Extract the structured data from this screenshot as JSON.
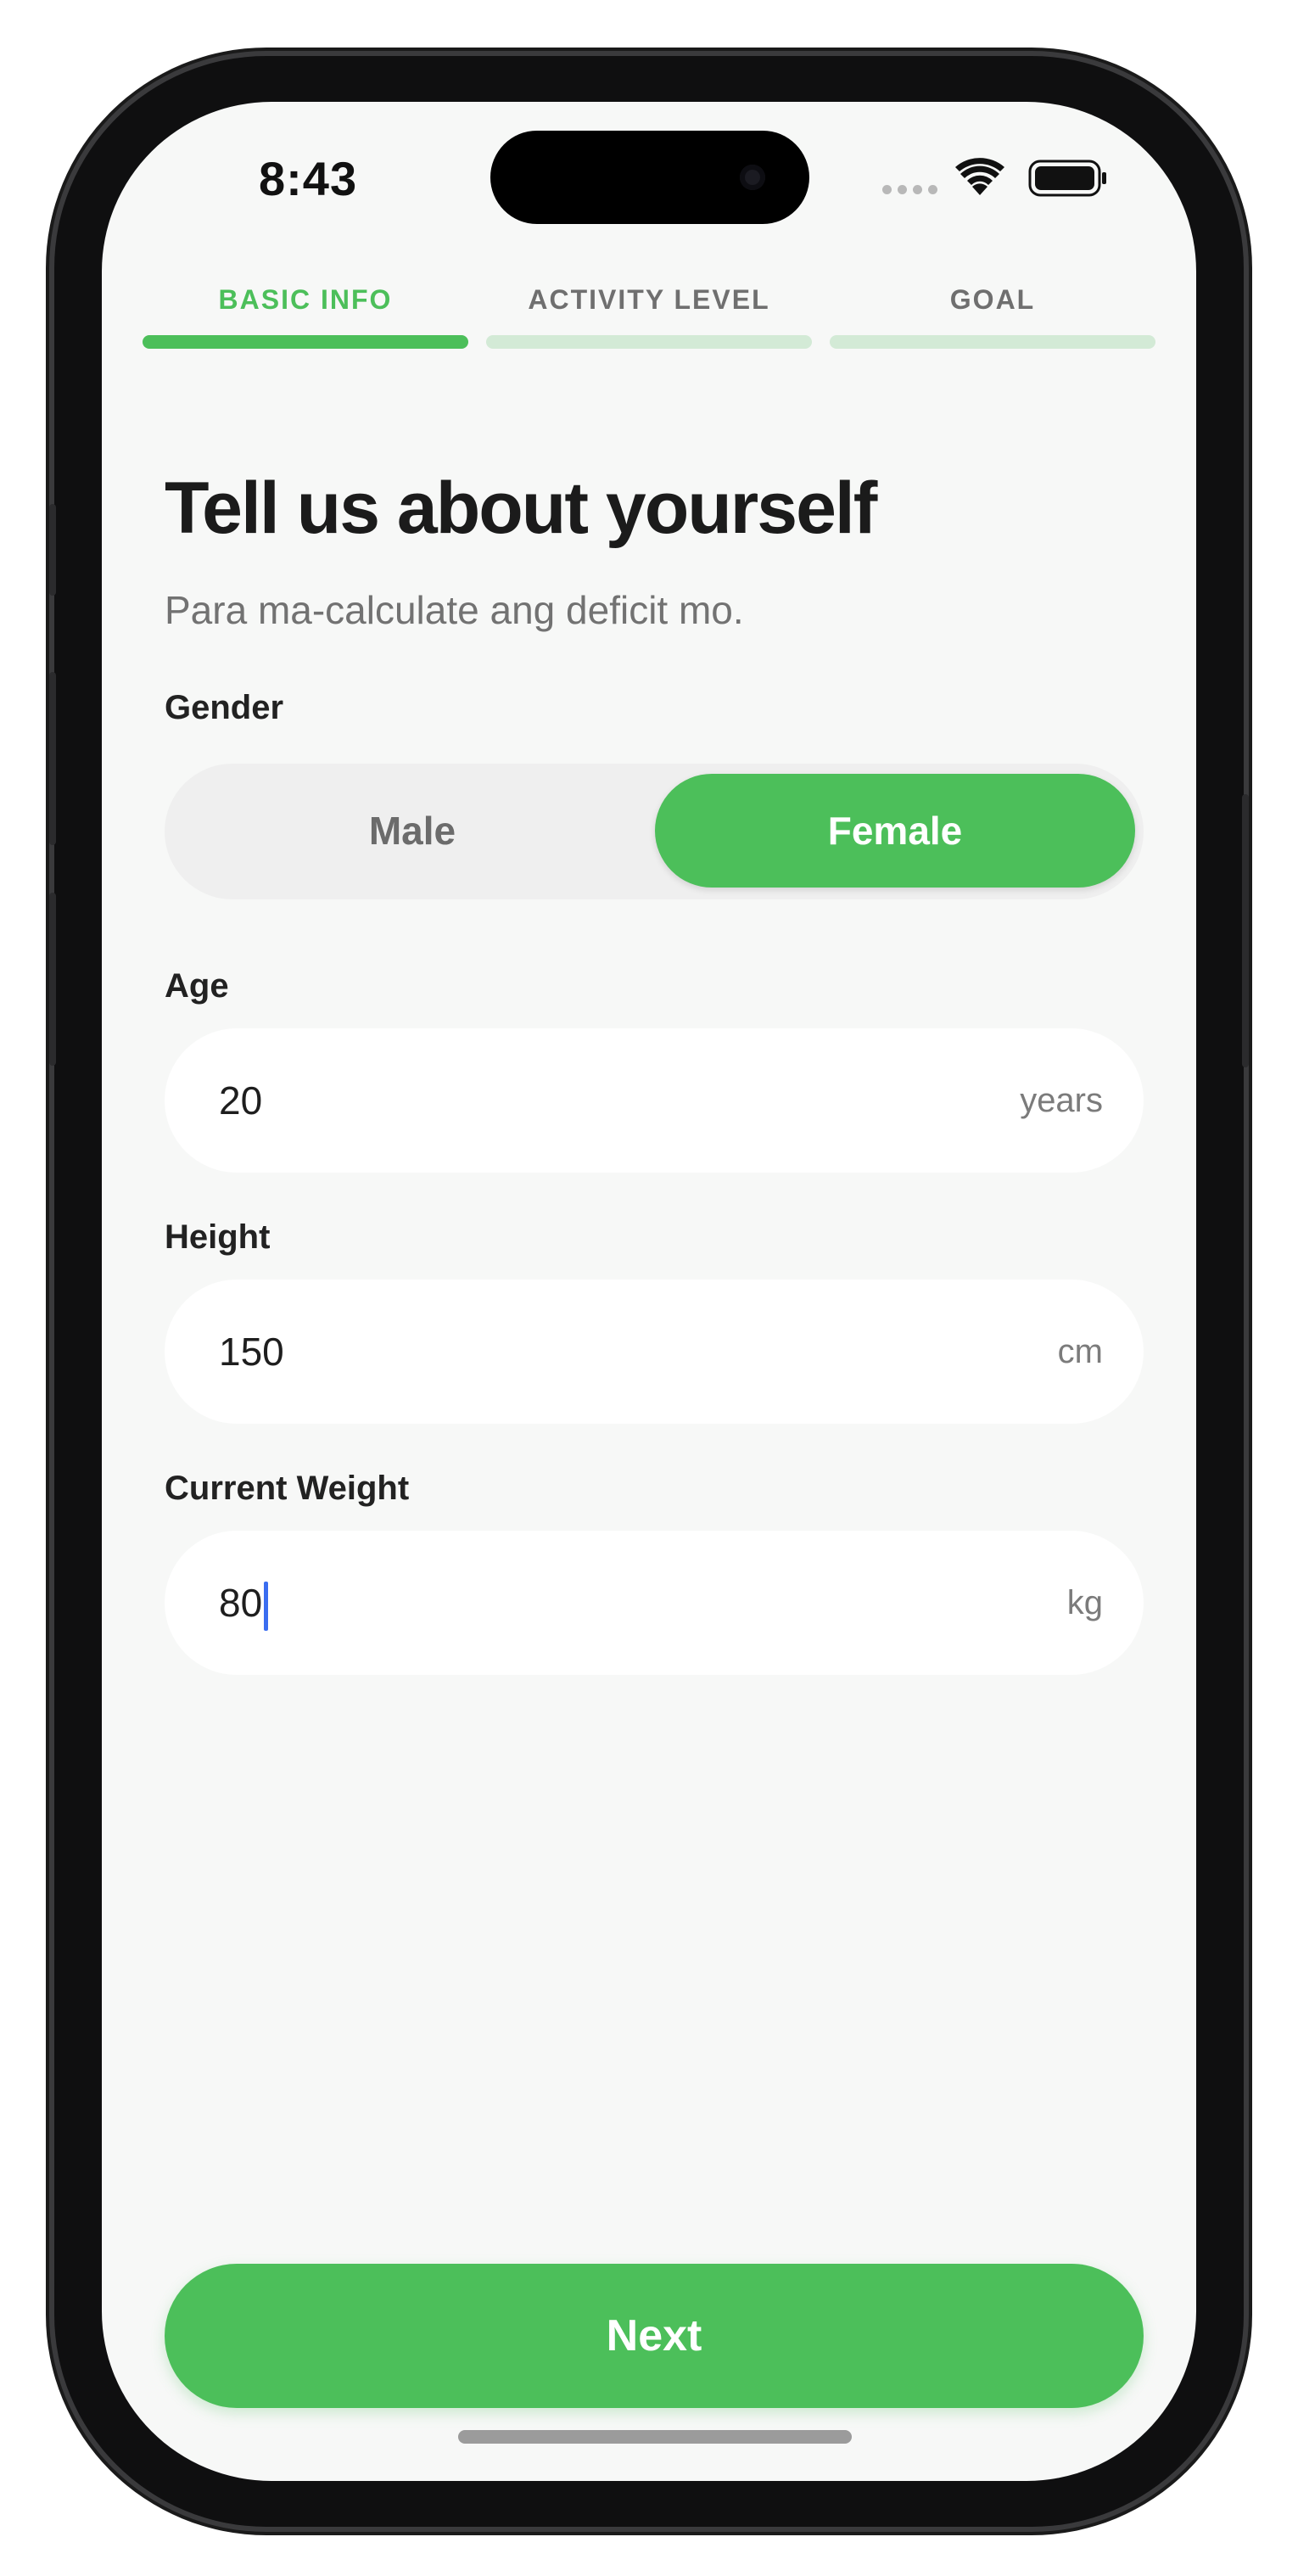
{
  "status_bar": {
    "time": "8:43",
    "icons": [
      "cellular-signal-icon",
      "wifi-icon",
      "battery-icon"
    ]
  },
  "tabs": [
    {
      "label": "BASIC INFO",
      "active": true
    },
    {
      "label": "ACTIVITY LEVEL",
      "active": false
    },
    {
      "label": "GOAL",
      "active": false
    }
  ],
  "page": {
    "title": "Tell us about yourself",
    "subtitle": "Para ma-calculate ang deficit mo."
  },
  "gender": {
    "label": "Gender",
    "options": [
      "Male",
      "Female"
    ],
    "selected": "Female"
  },
  "age": {
    "label": "Age",
    "value": "20",
    "unit": "years"
  },
  "height": {
    "label": "Height",
    "value": "150",
    "unit": "cm"
  },
  "weight": {
    "label": "Current Weight",
    "value": "80",
    "unit": "kg"
  },
  "actions": {
    "next_label": "Next"
  },
  "colors": {
    "accent": "#4cbf5a",
    "accent_light": "#d3ead6",
    "background": "#f7f8f7",
    "caret": "#3a6df0"
  }
}
